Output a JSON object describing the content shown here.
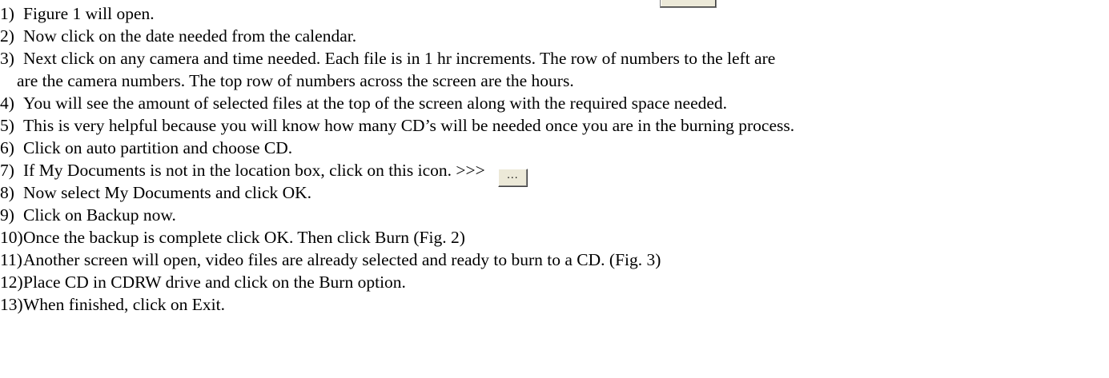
{
  "steps": [
    {
      "num": "1)",
      "text": "Figure 1 will open."
    },
    {
      "num": "2)",
      "text": "Now click on the date needed from the calendar."
    },
    {
      "num": "3)",
      "text": "Next click on any camera and time needed.  Each file is in 1 hr increments.  The row of numbers to the left are",
      "cont": "are the camera numbers.  The top row of numbers across the screen are the hours."
    },
    {
      "num": "4)",
      "text": "You will see the amount of selected files at the top of the screen along with the required space needed."
    },
    {
      "num": "5)",
      "text": "This is very helpful because you will know how many CD’s will be needed once you are in the burning process."
    },
    {
      "num": "6)",
      "text": "Click on auto partition and choose CD."
    },
    {
      "num": "7)",
      "text": "If  My Documents is not in the location box, click on this icon.  >>>",
      "button_label": "..."
    },
    {
      "num": "8)",
      "text": "Now select My Documents and click OK."
    },
    {
      "num": "9)",
      "text": "Click on Backup now."
    },
    {
      "num": "10)",
      "text": "Once the backup is complete click OK.  Then click Burn (Fig. 2)"
    },
    {
      "num": "11)",
      "text": "Another screen will open, video files are already selected and ready to burn to a CD. (Fig. 3)"
    },
    {
      "num": "12)",
      "text": "Place CD in CDRW drive and click on the Burn option."
    },
    {
      "num": "13)",
      "text": "When finished, click on Exit."
    }
  ]
}
